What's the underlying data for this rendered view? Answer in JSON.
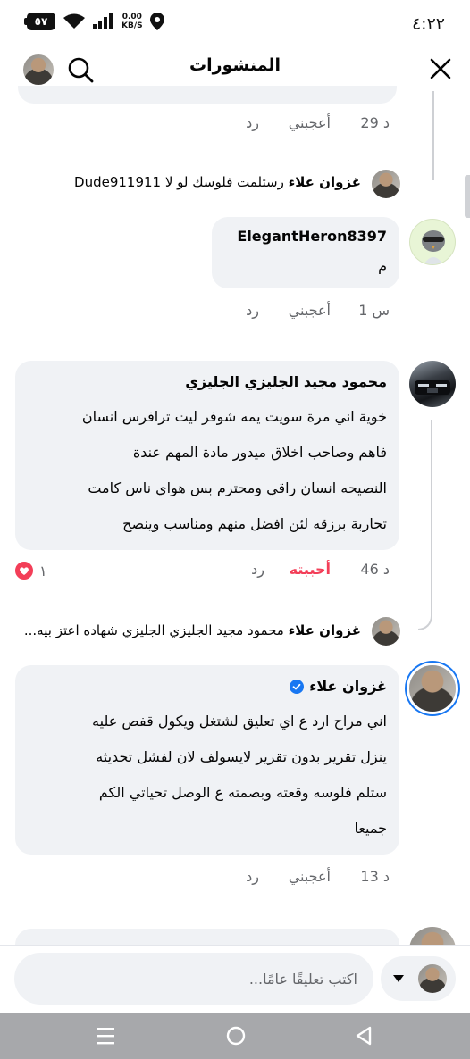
{
  "status_bar": {
    "time": "٤:٢٢",
    "battery": "٥٧",
    "network_speed": "KB/S",
    "network_speed_value": "0.00"
  },
  "header": {
    "title": "المنشورات"
  },
  "comments": [
    {
      "meta": {
        "time": "29 د",
        "like": "أعجبني",
        "reply": "رد"
      }
    },
    {
      "reply_link": {
        "author": "غزوان علاء",
        "text": "رستلمت فلوسك لو لا Dude911911"
      }
    },
    {
      "author": "ElegantHeron8397",
      "text": [
        "م"
      ],
      "meta": {
        "time": "1 س",
        "like": "أعجبني",
        "reply": "رد"
      }
    },
    {
      "author": "محمود مجيد الجليزي الجليزي",
      "text": [
        "خوية اني مرة سويت يمه شوفر ليت ترافرس انسان",
        "فاهم وصاحب اخلاق ميدور مادة المهم عندة",
        "النصيحه انسان راقي ومحترم بس هواي ناس كامت",
        "تحاربة برزقه لئن افضل منهم ومناسب وينصح"
      ],
      "meta": {
        "time": "46 د",
        "like": "أحببته",
        "reply": "رد",
        "reaction_count": "١"
      }
    },
    {
      "reply_link": {
        "author": "غزوان علاء",
        "text": "محمود مجيد الجليزي الجليزي شهاده اعتز بيه..."
      }
    },
    {
      "author": "غزوان علاء",
      "verified": true,
      "text": [
        "اني مراح ارد ع اي تعليق لشتغل ويكول قفص عليه",
        "ينزل تقرير بدون تقرير لايسولف لان لفشل تحديثه",
        "ستلم فلوسه وقعته وبصمته ع الوصل تحياتي الكم",
        "جميعا"
      ],
      "meta": {
        "time": "13 د",
        "like": "أعجبني",
        "reply": "رد"
      }
    }
  ],
  "composer": {
    "placeholder": "اكتب تعليقًا عامًا..."
  },
  "colors": {
    "bubble": "#f0f2f5",
    "meta_text": "#65676b",
    "love_red": "#f33e58",
    "verified_blue": "#1877f2",
    "nav_bar": "#a7a8ab"
  },
  "icons": {
    "close": "close-icon",
    "search": "search-icon",
    "heart": "heart-icon",
    "verified": "verified-badge-icon",
    "dropdown": "caret-down-icon",
    "nav_recents": "recents-icon",
    "nav_home": "home-icon",
    "nav_back": "back-icon"
  }
}
